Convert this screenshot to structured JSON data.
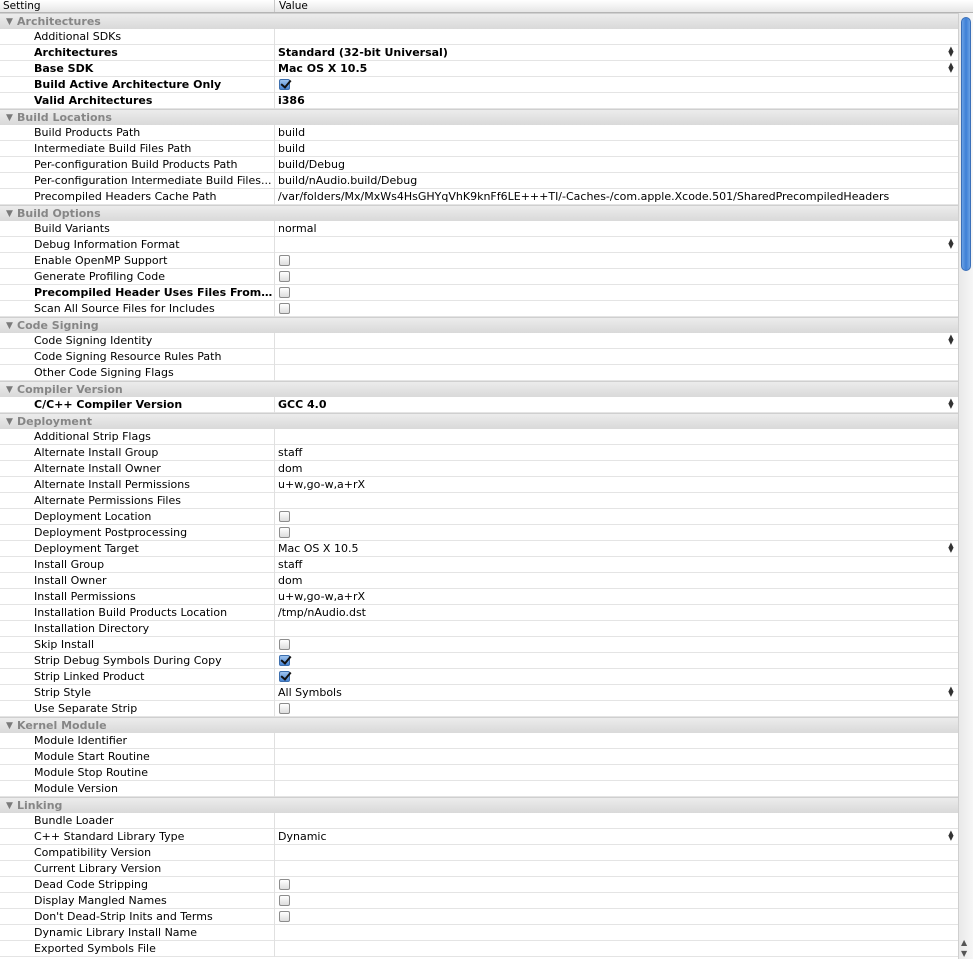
{
  "header": {
    "setting": "Setting",
    "value": "Value"
  },
  "rows": [
    {
      "kind": "group",
      "label": "Architectures"
    },
    {
      "kind": "text",
      "name": "Additional SDKs",
      "value": ""
    },
    {
      "kind": "popup",
      "name": "Architectures",
      "value": "Standard (32-bit Universal)",
      "bold": true
    },
    {
      "kind": "popup",
      "name": "Base SDK",
      "value": "Mac OS X 10.5",
      "bold": true
    },
    {
      "kind": "check",
      "name": "Build Active Architecture Only",
      "checked": true,
      "bold": true
    },
    {
      "kind": "text",
      "name": "Valid Architectures",
      "value": "i386",
      "bold": true
    },
    {
      "kind": "group",
      "label": "Build Locations"
    },
    {
      "kind": "text",
      "name": "Build Products Path",
      "value": "build"
    },
    {
      "kind": "text",
      "name": "Intermediate Build Files Path",
      "value": "build"
    },
    {
      "kind": "text",
      "name": "Per-configuration Build Products Path",
      "value": "build/Debug"
    },
    {
      "kind": "text",
      "name": "Per-configuration Intermediate Build Files...",
      "value": "build/nAudio.build/Debug"
    },
    {
      "kind": "text",
      "name": "Precompiled Headers Cache Path",
      "value": "/var/folders/Mx/MxWs4HsGHYqVhK9knFf6LE+++TI/-Caches-/com.apple.Xcode.501/SharedPrecompiledHeaders"
    },
    {
      "kind": "group",
      "label": "Build Options"
    },
    {
      "kind": "text",
      "name": "Build Variants",
      "value": "normal"
    },
    {
      "kind": "popup",
      "name": "Debug Information Format",
      "value": ""
    },
    {
      "kind": "check",
      "name": "Enable OpenMP Support",
      "checked": false
    },
    {
      "kind": "check",
      "name": "Generate Profiling Code",
      "checked": false
    },
    {
      "kind": "check",
      "name": "Precompiled Header Uses Files From Bu...",
      "checked": false,
      "bold": true
    },
    {
      "kind": "check",
      "name": "Scan All Source Files for Includes",
      "checked": false
    },
    {
      "kind": "group",
      "label": "Code Signing"
    },
    {
      "kind": "popup",
      "name": "Code Signing Identity",
      "value": ""
    },
    {
      "kind": "text",
      "name": "Code Signing Resource Rules Path",
      "value": ""
    },
    {
      "kind": "text",
      "name": "Other Code Signing Flags",
      "value": ""
    },
    {
      "kind": "group",
      "label": "Compiler Version"
    },
    {
      "kind": "popup",
      "name": "C/C++ Compiler Version",
      "value": "GCC 4.0",
      "bold": true
    },
    {
      "kind": "group",
      "label": "Deployment"
    },
    {
      "kind": "text",
      "name": "Additional Strip Flags",
      "value": ""
    },
    {
      "kind": "text",
      "name": "Alternate Install Group",
      "value": "staff"
    },
    {
      "kind": "text",
      "name": "Alternate Install Owner",
      "value": "dom"
    },
    {
      "kind": "text",
      "name": "Alternate Install Permissions",
      "value": "u+w,go-w,a+rX"
    },
    {
      "kind": "text",
      "name": "Alternate Permissions Files",
      "value": ""
    },
    {
      "kind": "check",
      "name": "Deployment Location",
      "checked": false
    },
    {
      "kind": "check",
      "name": "Deployment Postprocessing",
      "checked": false
    },
    {
      "kind": "popup",
      "name": "Deployment Target",
      "value": "Mac OS X 10.5"
    },
    {
      "kind": "text",
      "name": "Install Group",
      "value": "staff"
    },
    {
      "kind": "text",
      "name": "Install Owner",
      "value": "dom"
    },
    {
      "kind": "text",
      "name": "Install Permissions",
      "value": "u+w,go-w,a+rX"
    },
    {
      "kind": "text",
      "name": "Installation Build Products Location",
      "value": "/tmp/nAudio.dst"
    },
    {
      "kind": "text",
      "name": "Installation Directory",
      "value": ""
    },
    {
      "kind": "check",
      "name": "Skip Install",
      "checked": false
    },
    {
      "kind": "check",
      "name": "Strip Debug Symbols During Copy",
      "checked": true
    },
    {
      "kind": "check",
      "name": "Strip Linked Product",
      "checked": true
    },
    {
      "kind": "popup",
      "name": "Strip Style",
      "value": "All Symbols"
    },
    {
      "kind": "check",
      "name": "Use Separate Strip",
      "checked": false
    },
    {
      "kind": "group",
      "label": "Kernel Module"
    },
    {
      "kind": "text",
      "name": "Module Identifier",
      "value": ""
    },
    {
      "kind": "text",
      "name": "Module Start Routine",
      "value": ""
    },
    {
      "kind": "text",
      "name": "Module Stop Routine",
      "value": ""
    },
    {
      "kind": "text",
      "name": "Module Version",
      "value": ""
    },
    {
      "kind": "group",
      "label": "Linking"
    },
    {
      "kind": "text",
      "name": "Bundle Loader",
      "value": ""
    },
    {
      "kind": "popup",
      "name": "C++ Standard Library Type",
      "value": "Dynamic"
    },
    {
      "kind": "text",
      "name": "Compatibility Version",
      "value": ""
    },
    {
      "kind": "text",
      "name": "Current Library Version",
      "value": ""
    },
    {
      "kind": "check",
      "name": "Dead Code Stripping",
      "checked": false
    },
    {
      "kind": "check",
      "name": "Display Mangled Names",
      "checked": false
    },
    {
      "kind": "check",
      "name": "Don't Dead-Strip Inits and Terms",
      "checked": false
    },
    {
      "kind": "text",
      "name": "Dynamic Library Install Name",
      "value": ""
    },
    {
      "kind": "text",
      "name": "Exported Symbols File",
      "value": ""
    }
  ],
  "colors": {
    "scroll_thumb": "#3d7fd6",
    "group_text": "#868686",
    "checkbox_checked": "#4a86d4"
  }
}
